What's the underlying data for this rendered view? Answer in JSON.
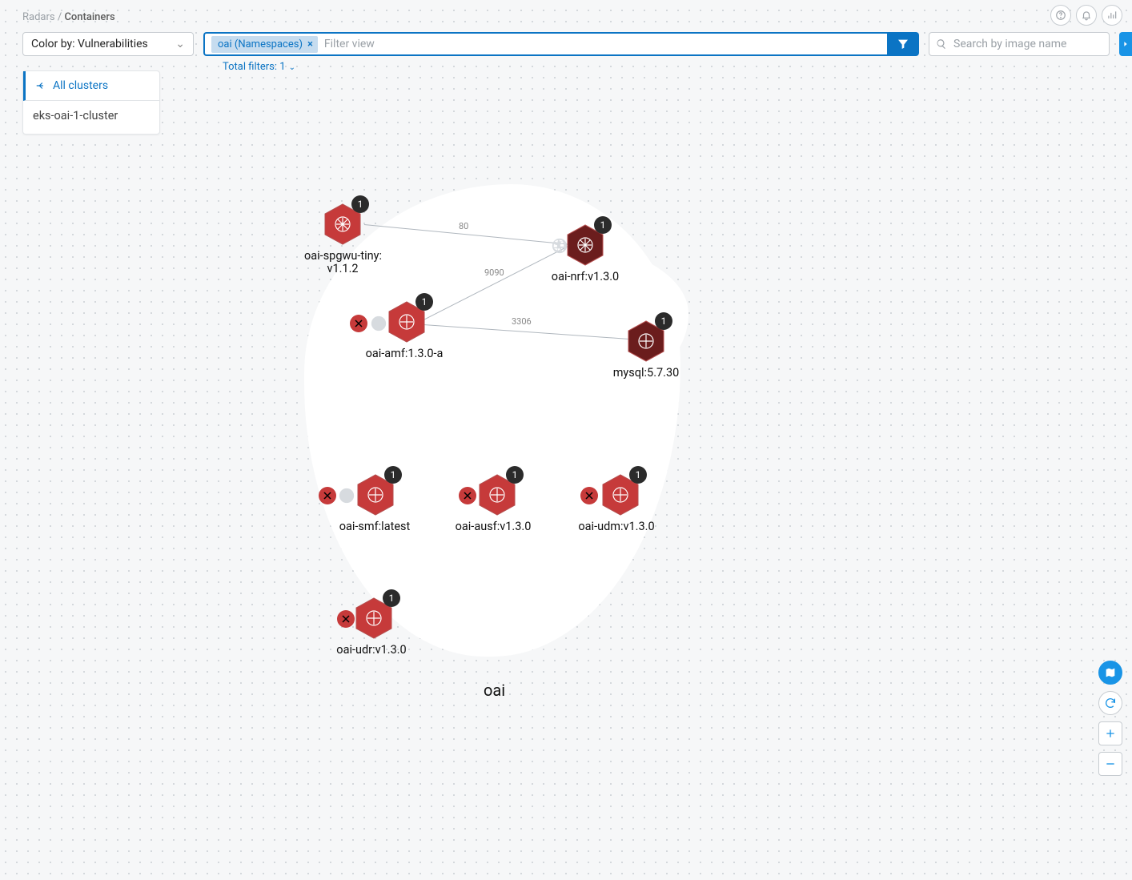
{
  "breadcrumb": {
    "root": "Radars",
    "current": "Containers"
  },
  "colorby": {
    "full": "Color by: Vulnerabilities"
  },
  "filter": {
    "chip": "oai (Namespaces)",
    "placeholder": "Filter view",
    "total": "Total filters: 1"
  },
  "search": {
    "placeholder": "Search by image name"
  },
  "clusterPicker": {
    "back": "All clusters",
    "name": "eks-oai-1-cluster"
  },
  "namespace": "oai",
  "edges": {
    "spgwu_nrf": "80",
    "amf_nrf": "9090",
    "amf_mysql": "3306"
  },
  "nodes": {
    "spgwu": {
      "label": "oai-spgwu-tiny:\nv1.1.2",
      "count": "1"
    },
    "nrf": {
      "label": "oai-nrf:v1.3.0",
      "count": "1"
    },
    "amf": {
      "label": "oai-amf:1.3.0-a",
      "count": "1"
    },
    "mysql": {
      "label": "mysql:5.7.30",
      "count": "1"
    },
    "smf": {
      "label": "oai-smf:latest",
      "count": "1"
    },
    "ausf": {
      "label": "oai-ausf:v1.3.0",
      "count": "1"
    },
    "udm": {
      "label": "oai-udm:v1.3.0",
      "count": "1"
    },
    "udr": {
      "label": "oai-udr:v1.3.0",
      "count": "1"
    }
  }
}
